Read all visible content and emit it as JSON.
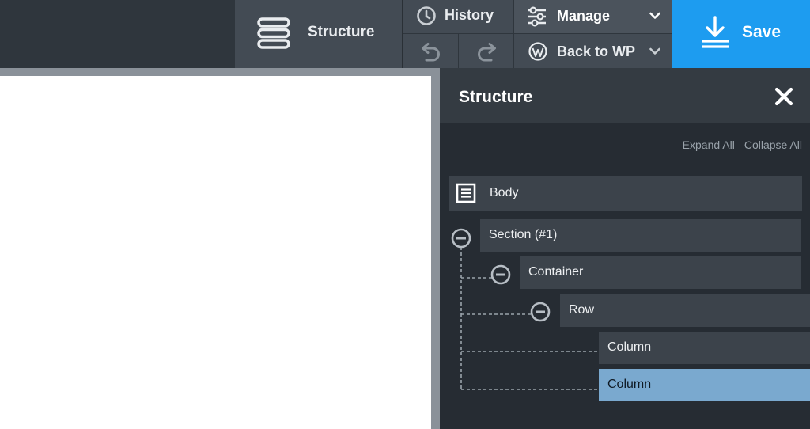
{
  "toolbar": {
    "structure_label": "Structure",
    "history_label": "History",
    "manage_label": "Manage",
    "back_label": "Back to WP",
    "save_label": "Save"
  },
  "panel": {
    "title": "Structure",
    "expand_all": "Expand All",
    "collapse_all": "Collapse All",
    "tree": [
      {
        "label": "Body"
      },
      {
        "label": "Section (#1)"
      },
      {
        "label": "Container"
      },
      {
        "label": "Row"
      },
      {
        "label": "Column"
      },
      {
        "label": "Column",
        "selected": true
      }
    ]
  },
  "colors": {
    "accent": "#1d9cf0",
    "selected_node": "#7aa9cf",
    "toolbar_bg": "#434b54",
    "panel_bg": "#262c33"
  },
  "icons": {
    "structure": "structure-icon",
    "history": "clock-icon",
    "manage": "sliders-icon",
    "undo": "undo-icon",
    "redo": "redo-icon",
    "back": "wordpress-icon",
    "save": "download-icon",
    "close": "close-icon",
    "body": "document-icon",
    "collapse": "minus-circle-icon"
  }
}
